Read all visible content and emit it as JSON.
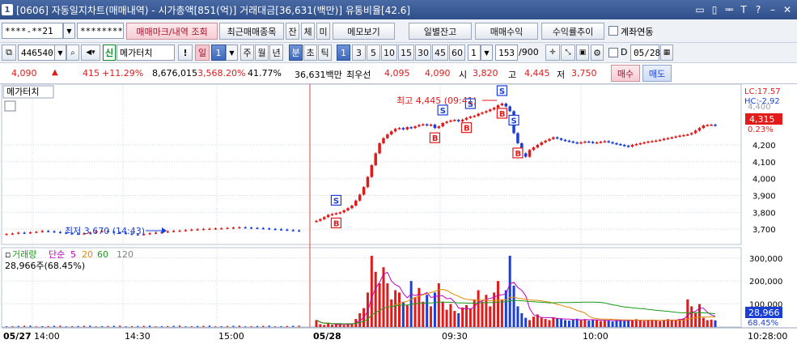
{
  "window": {
    "number": "1",
    "title": "[0606] 자동일지차트(매매내역) - 시가총액[851(억)] 거래대금[36,631(백만)] 유통비율[42.6]",
    "controls": [
      "▭",
      "▯",
      "ᆍ",
      "T",
      "?",
      "–",
      "✕"
    ]
  },
  "toolbar1": {
    "account": "****-**21",
    "password": "********",
    "btn_trade_marks": "매매마크/내역 조회",
    "btn_recent_trades": "최근매매종목",
    "btn_jan": "잔",
    "btn_che": "체",
    "btn_mi": "미",
    "btn_memo": "메모보기",
    "btn_daily_balance": "일별잔고",
    "btn_trade_profit": "매매수익",
    "btn_return_trend": "수익률추이",
    "linked_account_label": "계좌연동"
  },
  "toolbar2": {
    "stock_code": "446540",
    "new_badge": "신",
    "stock_name": "메가터치",
    "excl": "!",
    "period_day": "일",
    "period_num": "1",
    "periods": [
      "주",
      "월",
      "년",
      "분",
      "초",
      "틱"
    ],
    "minute_selected": "분",
    "intervals": [
      "1",
      "3",
      "5",
      "10",
      "15",
      "30",
      "45",
      "60"
    ],
    "interval_selected": "1",
    "count_select": "1",
    "count_value": "153",
    "count_total": "/900",
    "d_label": "D",
    "date": "05/28"
  },
  "quote": {
    "price": "4,090",
    "arrow": "▲",
    "change": "415",
    "change_pct": "+11.29%",
    "volume": "8,676,015",
    "vol_ratio": "3,568.20%",
    "turnover": "41.77%",
    "amount": "36,631백만",
    "best_label": "최우선",
    "ask": "4,095",
    "bid": "4,090",
    "open_label": "시",
    "open": "3,820",
    "high_label": "고",
    "high": "4,445",
    "low_label": "저",
    "low": "3,750",
    "buy": "매수",
    "sell": "매도"
  },
  "chart": {
    "stock_tag": "메가터치",
    "lc": "LC:17.57",
    "hc": "HC:-2.92",
    "hc_value": "4,400",
    "cur_price": "4,315",
    "cur_pct": "0.23%",
    "high_annot": "최고 4,445 (09:41)",
    "low_annot": "최저 3,670 (14:43)",
    "vol_title": "거래량",
    "vol_ma_label": "단순",
    "vol_ma": [
      "5",
      "20",
      "60",
      "120"
    ],
    "vol_ma_colors": [
      "#c000c0",
      "#e08a00",
      "#1a9a1a",
      "#808080"
    ],
    "vol_info": "28,966주(68.45%)",
    "vol_cur": "28,966",
    "vol_cur_pct": "68.45%",
    "time_end": "10:28:00",
    "colors": {
      "up": "#e21a1a",
      "down": "#1a3fd6",
      "grid": "#c8d4e6",
      "sep": "#e04040"
    }
  },
  "chart_data": {
    "type": "candlestick",
    "price_axis": {
      "ticks": [
        3700,
        3800,
        3900,
        4000,
        4100,
        4200
      ],
      "ylim": [
        3610,
        4560
      ]
    },
    "volume_axis": {
      "ticks": [
        100000,
        200000,
        300000
      ],
      "ylim": [
        0,
        345000
      ]
    },
    "time_labels": [
      {
        "t": 0,
        "label": "05/27"
      },
      {
        "t": 1,
        "label": "14:00"
      },
      {
        "t": 2,
        "label": "14:30"
      },
      {
        "t": 3,
        "label": "15:00"
      },
      {
        "t": 4,
        "label": "05/28"
      },
      {
        "t": 5,
        "label": "09:30"
      },
      {
        "t": 6,
        "label": "10:00"
      }
    ],
    "day1_closes": [
      3672,
      3675,
      3680,
      3678,
      3682,
      3685,
      3690,
      3688,
      3684,
      3680,
      3677,
      3675,
      3672,
      3676,
      3681,
      3686,
      3690,
      3686,
      3682,
      3678,
      3675,
      3670,
      3668,
      3672,
      3677,
      3680,
      3683,
      3688,
      3690,
      3692,
      3695,
      3698,
      3700,
      3702,
      3703,
      3705,
      3706,
      3708,
      3710,
      3712,
      3710,
      3708,
      3707,
      3705,
      3702,
      3700,
      3698,
      3695,
      3693,
      3690
    ],
    "day2_closes": [
      3750,
      3760,
      3772,
      3785,
      3790,
      3795,
      3800,
      3812,
      3825,
      3840,
      3870,
      3905,
      3950,
      4010,
      4080,
      4150,
      4210,
      4240,
      4262,
      4280,
      4295,
      4300,
      4292,
      4305,
      4300,
      4310,
      4318,
      4322,
      4315,
      4320,
      4300,
      4310,
      4330,
      4338,
      4345,
      4348,
      4340,
      4350,
      4360,
      4368,
      4372,
      4385,
      4392,
      4400,
      4410,
      4420,
      4435,
      4445,
      4428,
      4400,
      4270,
      4210,
      4150,
      4130,
      4170,
      4185,
      4200,
      4215,
      4225,
      4235,
      4245,
      4238,
      4230,
      4225,
      4220,
      4215,
      4210,
      4215,
      4220,
      4218,
      4212,
      4215,
      4218,
      4222,
      4216,
      4210,
      4205,
      4200,
      4195,
      4190,
      4200,
      4205,
      4210,
      4215,
      4220,
      4222,
      4226,
      4230,
      4236,
      4240,
      4245,
      4250,
      4255,
      4258,
      4262,
      4270,
      4285,
      4300,
      4315,
      4318,
      4320,
      4315
    ],
    "day2_volume": [
      30000,
      12000,
      9000,
      15000,
      10000,
      11000,
      14000,
      9000,
      16000,
      14000,
      35000,
      60000,
      82000,
      150000,
      310000,
      240000,
      190000,
      260000,
      190000,
      120000,
      160000,
      150000,
      110000,
      95000,
      200000,
      130000,
      170000,
      110000,
      140000,
      90000,
      150000,
      190000,
      110000,
      75000,
      100000,
      70000,
      60000,
      85000,
      95000,
      80000,
      120000,
      160000,
      110000,
      140000,
      90000,
      150000,
      200000,
      120000,
      160000,
      310000,
      180000,
      90000,
      60000,
      40000,
      30000,
      45000,
      55000,
      40000,
      35000,
      30000,
      42000,
      38000,
      35000,
      30000,
      28000,
      32000,
      36000,
      30000,
      34000,
      28000,
      30000,
      32000,
      26000,
      30000,
      28000,
      24000,
      30000,
      32000,
      26000,
      28000,
      30000,
      34000,
      28000,
      26000,
      30000,
      32000,
      28000,
      25000,
      30000,
      34000,
      32000,
      30000,
      35000,
      38000,
      120000,
      90000,
      60000,
      100000,
      40000,
      30000,
      32000,
      28966
    ],
    "buy_markers": [
      5,
      30,
      38,
      47,
      51
    ],
    "sell_markers": [
      5,
      32,
      39,
      47,
      50
    ]
  }
}
